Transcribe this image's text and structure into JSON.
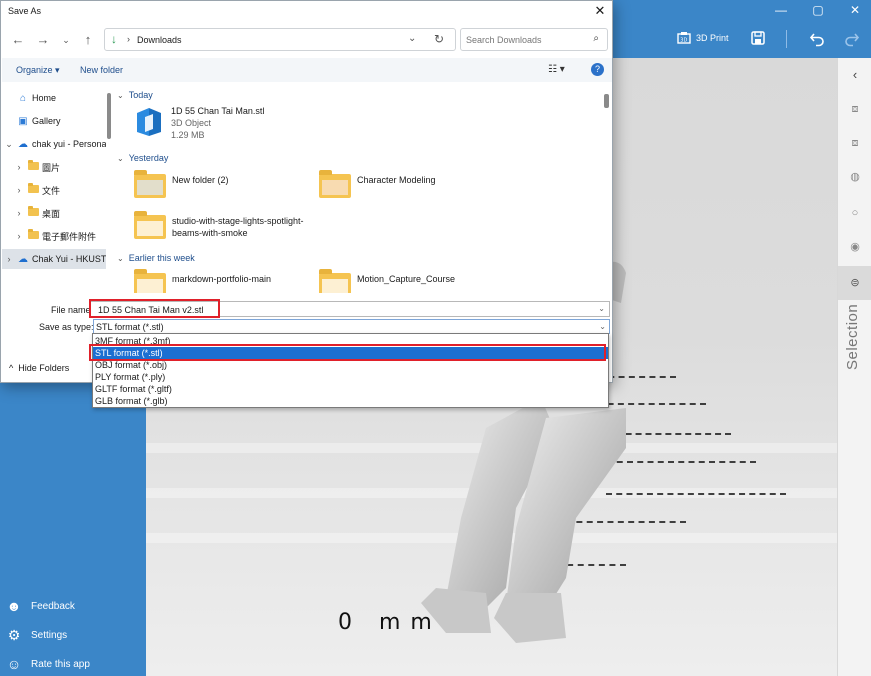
{
  "app": {
    "window_controls": [
      "—",
      "▢",
      "✕"
    ],
    "toolbar": {
      "print_label": "3D Print"
    },
    "left_menu": [
      {
        "icon": "feedback-icon",
        "glyph": "☻",
        "label": "Feedback"
      },
      {
        "icon": "settings-icon",
        "glyph": "⚙",
        "label": "Settings"
      },
      {
        "icon": "smiley-icon",
        "glyph": "☺",
        "label": "Rate this app"
      }
    ],
    "right_panel": {
      "selection_label": "Selection"
    },
    "canvas_floor_text": "0 mm"
  },
  "dialog": {
    "title": "Save As",
    "close_glyph": "✕",
    "address": {
      "path": "Downloads"
    },
    "search": {
      "placeholder": "Search Downloads"
    },
    "toolbar": {
      "organize": "Organize ▾",
      "new_folder": "New folder",
      "help": "?"
    },
    "nav_pane": [
      {
        "label": "Home",
        "icon": "home-icon",
        "glyph": "⌂",
        "expand": "",
        "selected": false
      },
      {
        "label": "Gallery",
        "icon": "gallery-icon",
        "glyph": "▣",
        "expand": "",
        "selected": false
      },
      {
        "label": "chak yui - Personal",
        "icon": "cloud-icon",
        "glyph": "☁",
        "expand": "⌄",
        "selected": false
      },
      {
        "label": "圖片",
        "icon": "folder-icon",
        "glyph": "",
        "expand": "›",
        "selected": false
      },
      {
        "label": "文件",
        "icon": "folder-icon",
        "glyph": "",
        "expand": "›",
        "selected": false
      },
      {
        "label": "桌面",
        "icon": "folder-icon",
        "glyph": "",
        "expand": "›",
        "selected": false
      },
      {
        "label": "電子郵件附件",
        "icon": "folder-icon",
        "glyph": "",
        "expand": "›",
        "selected": false
      },
      {
        "label": "Chak Yui - HKUST",
        "icon": "cloud-icon",
        "glyph": "☁",
        "expand": "›",
        "selected": true
      }
    ],
    "groups": {
      "today": "Today",
      "yesterday": "Yesterday",
      "earlier": "Earlier this week"
    },
    "files": {
      "stl_file": {
        "name": "1D 55 Chan Tai Man.stl",
        "type": "3D Object",
        "size": "1.29 MB"
      },
      "new_folder": "New folder (2)",
      "character_modeling": "Character Modeling",
      "studio": "studio-with-stage-lights-spotlight-beams-with-smoke",
      "markdown": "markdown-portfolio-main",
      "motion": "Motion_Capture_Course"
    },
    "file_name_label": "File name:",
    "file_name_value": "1D 55 Chan Tai Man v2.stl",
    "save_type_label": "Save as type:",
    "save_type_value": "STL format (*.stl)",
    "type_options": [
      {
        "label": "3MF format (*.3mf)",
        "highlighted": false
      },
      {
        "label": "STL format (*.stl)",
        "highlighted": true
      },
      {
        "label": "OBJ format (*.obj)",
        "highlighted": false
      },
      {
        "label": "PLY format (*.ply)",
        "highlighted": false
      },
      {
        "label": "GLTF format (*.gltf)",
        "highlighted": false
      },
      {
        "label": "GLB format (*.glb)",
        "highlighted": false
      }
    ],
    "hide_folders": "Hide Folders",
    "colors": {
      "accent": "#1c6fd1",
      "annotation_red": "#e0202a",
      "app_blue": "#3b86c8",
      "folder": "#f5c451"
    }
  }
}
